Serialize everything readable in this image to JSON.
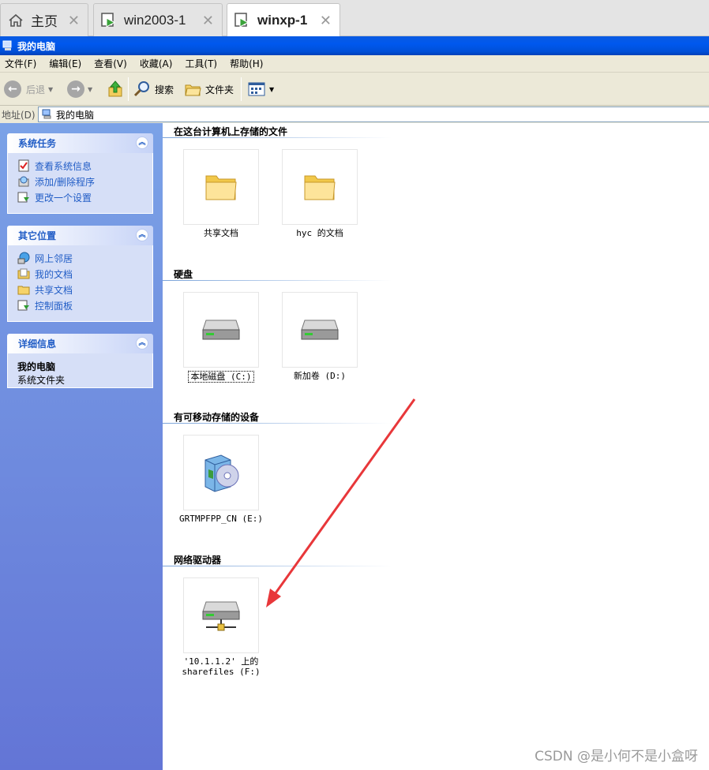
{
  "tabs": [
    {
      "label": "主页",
      "icon": "home-icon",
      "active": false
    },
    {
      "label": "win2003-1",
      "icon": "vm-icon",
      "active": false
    },
    {
      "label": "winxp-1",
      "icon": "vm-icon",
      "active": true
    }
  ],
  "window": {
    "title": "我的电脑"
  },
  "menu": [
    "文件(F)",
    "编辑(E)",
    "查看(V)",
    "收藏(A)",
    "工具(T)",
    "帮助(H)"
  ],
  "toolbar": {
    "back": "后退",
    "search": "搜索",
    "folders": "文件夹"
  },
  "address": {
    "label": "地址(D)",
    "value": "我的电脑"
  },
  "left_panels": {
    "system_tasks": {
      "title": "系统任务",
      "links": [
        "查看系统信息",
        "添加/删除程序",
        "更改一个设置"
      ]
    },
    "other_places": {
      "title": "其它位置",
      "links": [
        "网上邻居",
        "我的文档",
        "共享文档",
        "控制面板"
      ]
    },
    "details": {
      "title": "详细信息",
      "name": "我的电脑",
      "desc": "系统文件夹"
    }
  },
  "sections": {
    "files": {
      "title": "在这台计算机上存储的文件",
      "items": [
        "共享文档",
        "hyc 的文档"
      ]
    },
    "disks": {
      "title": "硬盘",
      "items": [
        "本地磁盘 (C:)",
        "新加卷 (D:)"
      ]
    },
    "removable": {
      "title": "有可移动存储的设备",
      "items": [
        "GRTMPFPP_CN (E:)"
      ]
    },
    "network": {
      "title": "网络驱动器",
      "items": [
        "'10.1.1.2' 上的",
        "sharefiles (F:)"
      ]
    }
  },
  "colors": {
    "xp_blue": "#0058ee",
    "panel_link": "#215dc6",
    "arrow": "#e8373a"
  },
  "watermark": "CSDN @是小何不是小盒呀"
}
